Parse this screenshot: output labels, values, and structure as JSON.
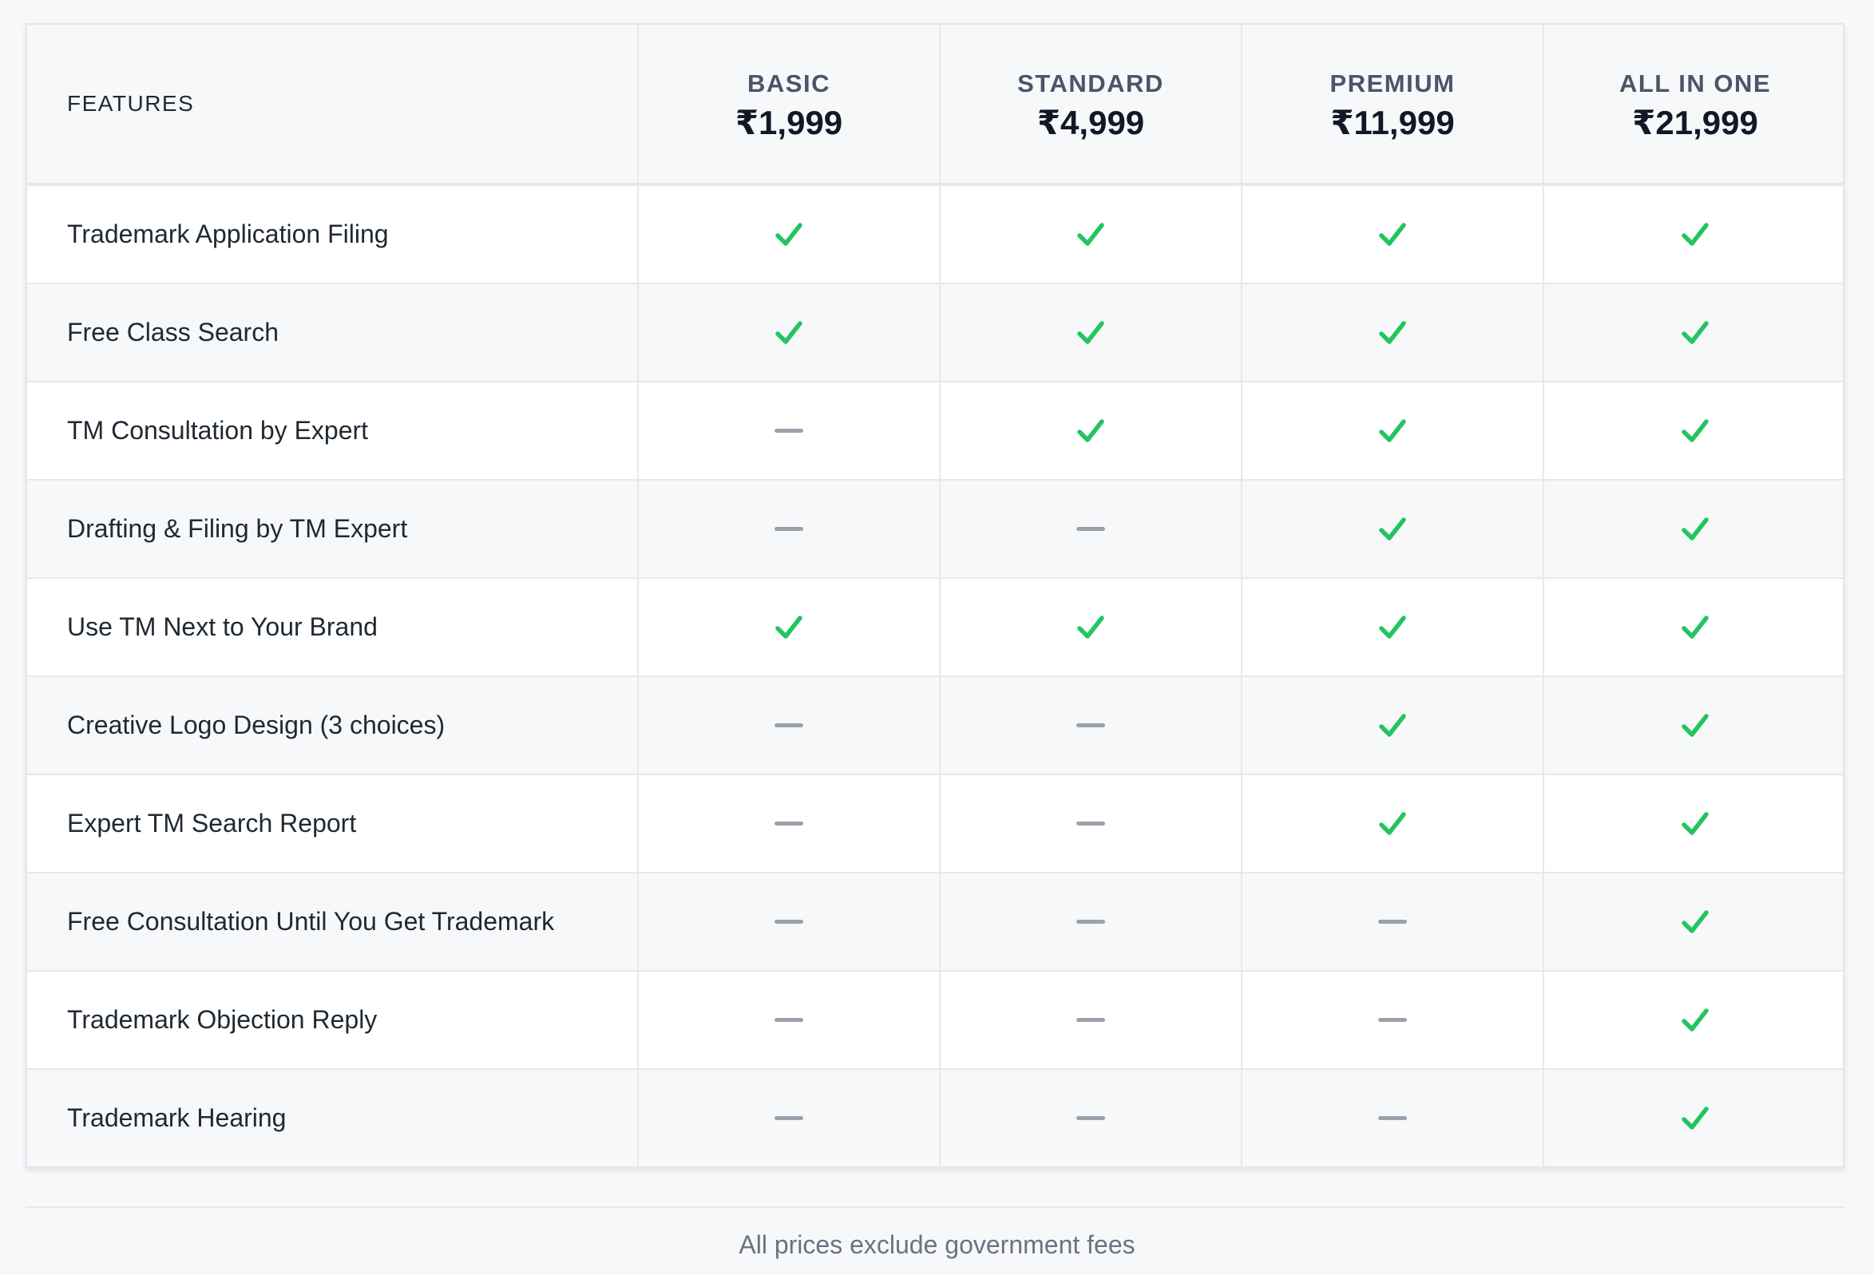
{
  "table": {
    "features_heading": "FEATURES",
    "plans": [
      {
        "name": "BASIC",
        "price": "₹1,999"
      },
      {
        "name": "STANDARD",
        "price": "₹4,999"
      },
      {
        "name": "PREMIUM",
        "price": "₹11,999"
      },
      {
        "name": "ALL IN ONE",
        "price": "₹21,999"
      }
    ],
    "rows": [
      {
        "feature": "Trademark Application Filing",
        "included": [
          true,
          true,
          true,
          true
        ]
      },
      {
        "feature": "Free Class Search",
        "included": [
          true,
          true,
          true,
          true
        ]
      },
      {
        "feature": "TM Consultation by Expert",
        "included": [
          false,
          true,
          true,
          true
        ]
      },
      {
        "feature": "Drafting & Filing by TM Expert",
        "included": [
          false,
          false,
          true,
          true
        ]
      },
      {
        "feature": "Use TM Next to Your Brand",
        "included": [
          true,
          true,
          true,
          true
        ]
      },
      {
        "feature": "Creative Logo Design (3 choices)",
        "included": [
          false,
          false,
          true,
          true
        ]
      },
      {
        "feature": "Expert TM Search Report",
        "included": [
          false,
          false,
          true,
          true
        ]
      },
      {
        "feature": "Free Consultation Until You Get Trademark",
        "included": [
          false,
          false,
          false,
          true
        ]
      },
      {
        "feature": "Trademark Objection Reply",
        "included": [
          false,
          false,
          false,
          true
        ]
      },
      {
        "feature": "Trademark Hearing",
        "included": [
          false,
          false,
          false,
          true
        ]
      }
    ]
  },
  "icons": {
    "included": "check-icon",
    "not_included": "dash-icon"
  },
  "colors": {
    "check": "#22c55e",
    "dash": "#9aa1ab",
    "header_background": "#f7f8fa",
    "stripe_background": "#f7f8fa"
  },
  "footer": {
    "note": "All prices exclude government fees"
  }
}
